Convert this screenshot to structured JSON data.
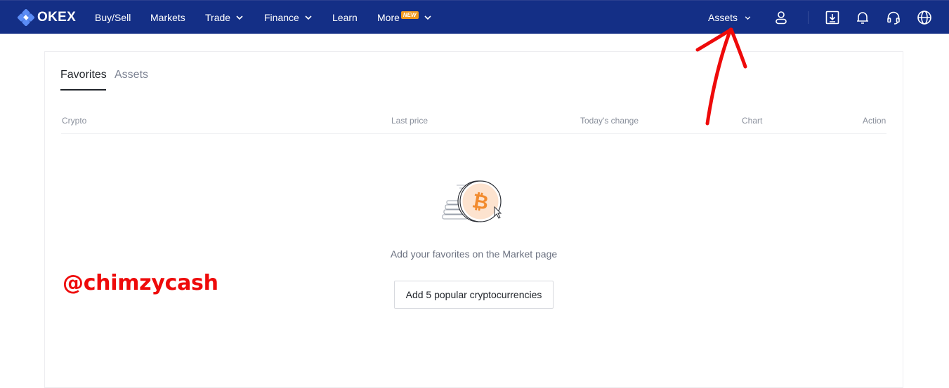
{
  "nav": {
    "logo_text": "OKEX",
    "items": [
      {
        "label": "Buy/Sell",
        "dropdown": false
      },
      {
        "label": "Markets",
        "dropdown": false
      },
      {
        "label": "Trade",
        "dropdown": true
      },
      {
        "label": "Finance",
        "dropdown": true
      },
      {
        "label": "Learn",
        "dropdown": false
      },
      {
        "label": "More",
        "dropdown": true,
        "badge": "NEW"
      }
    ],
    "assets_label": "Assets",
    "icons": [
      "user-icon",
      "download-icon",
      "bell-icon",
      "headset-icon",
      "globe-icon"
    ],
    "colors": {
      "bar": "#142f86",
      "badge": "#f39a1e"
    }
  },
  "panel": {
    "tabs": [
      {
        "label": "Favorites",
        "active": true
      },
      {
        "label": "Assets",
        "active": false
      }
    ],
    "columns": [
      "Crypto",
      "Last price",
      "Today's change",
      "Chart",
      "Action"
    ],
    "empty_icon": "bitcoin-coins-icon",
    "empty_message": "Add your favorites on the Market page",
    "add_button_label": "Add 5 popular cryptocurrencies"
  },
  "overlay": {
    "watermark_text": "@chimzycash",
    "annotation": "red-arrow-icon",
    "colors": {
      "watermark": "#ee0a0a",
      "arrow": "#ee0a0a"
    }
  }
}
